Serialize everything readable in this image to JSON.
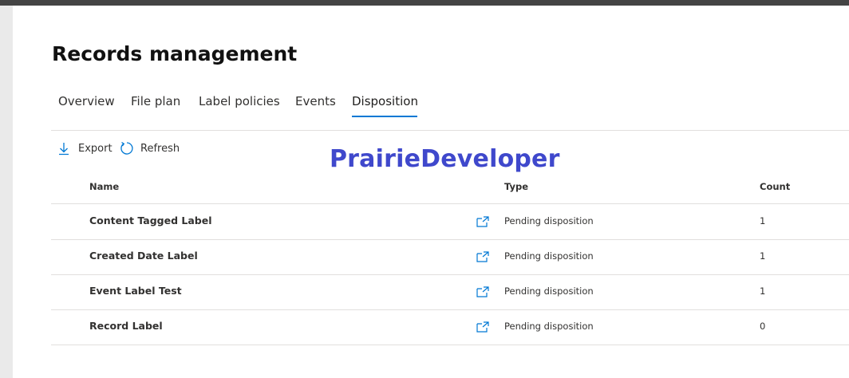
{
  "page": {
    "title": "Records management"
  },
  "tabs": [
    {
      "label": "Overview"
    },
    {
      "label": "File plan"
    },
    {
      "label": "Label policies"
    },
    {
      "label": "Events"
    },
    {
      "label": "Disposition",
      "active": true
    }
  ],
  "toolbar": {
    "export_label": "Export",
    "refresh_label": "Refresh",
    "export_icon": "download-icon",
    "refresh_icon": "refresh-icon"
  },
  "watermark": {
    "text": "PrairieDeveloper"
  },
  "table": {
    "headers": {
      "name": "Name",
      "type": "Type",
      "count": "Count"
    },
    "rows": [
      {
        "name": "Content Tagged Label",
        "type": "Pending disposition",
        "count": "1"
      },
      {
        "name": "Created Date Label",
        "type": "Pending disposition",
        "count": "1"
      },
      {
        "name": "Event Label Test",
        "type": "Pending disposition",
        "count": "1"
      },
      {
        "name": "Record Label",
        "type": "Pending disposition",
        "count": "0"
      }
    ]
  },
  "colors": {
    "accent": "#0078d4",
    "watermark": "#3f48cc",
    "topbar": "#444444"
  }
}
